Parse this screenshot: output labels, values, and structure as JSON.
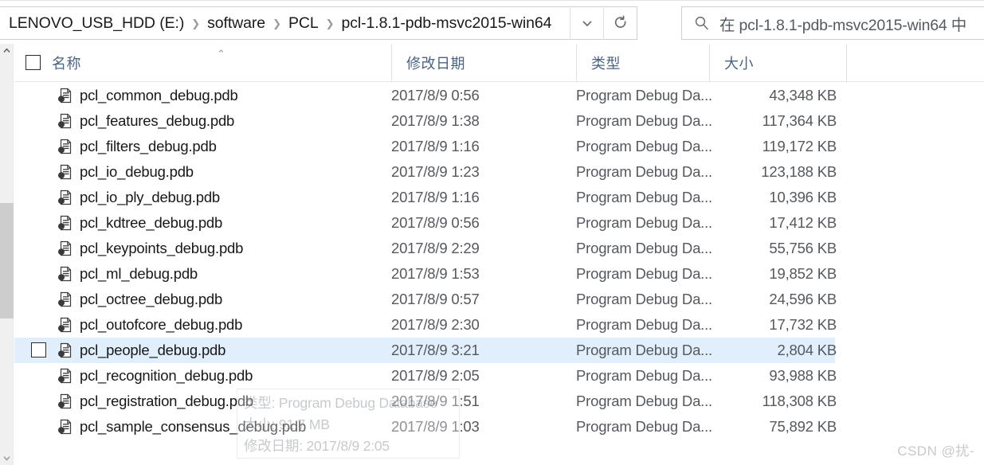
{
  "address_bar": {
    "breadcrumb": [
      "LENOVO_USB_HDD (E:)",
      "software",
      "PCL",
      "pcl-1.8.1-pdb-msvc2015-win64"
    ],
    "separator": "❯",
    "dropdown_icon": "chevron-down-icon",
    "refresh_icon": "refresh-icon"
  },
  "search": {
    "icon": "search-icon",
    "placeholder": "在 pcl-1.8.1-pdb-msvc2015-win64 中"
  },
  "columns": {
    "name": "名称",
    "date_modified": "修改日期",
    "type": "类型",
    "size": "大小",
    "sort_indicator": "⌃"
  },
  "files": [
    {
      "name": "pcl_common_debug.pdb",
      "date": "2017/8/9 0:56",
      "type": "Program Debug Da...",
      "size": "43,348 KB",
      "selected": false
    },
    {
      "name": "pcl_features_debug.pdb",
      "date": "2017/8/9 1:38",
      "type": "Program Debug Da...",
      "size": "117,364 KB",
      "selected": false
    },
    {
      "name": "pcl_filters_debug.pdb",
      "date": "2017/8/9 1:16",
      "type": "Program Debug Da...",
      "size": "119,172 KB",
      "selected": false
    },
    {
      "name": "pcl_io_debug.pdb",
      "date": "2017/8/9 1:23",
      "type": "Program Debug Da...",
      "size": "123,188 KB",
      "selected": false
    },
    {
      "name": "pcl_io_ply_debug.pdb",
      "date": "2017/8/9 1:16",
      "type": "Program Debug Da...",
      "size": "10,396 KB",
      "selected": false
    },
    {
      "name": "pcl_kdtree_debug.pdb",
      "date": "2017/8/9 0:56",
      "type": "Program Debug Da...",
      "size": "17,412 KB",
      "selected": false
    },
    {
      "name": "pcl_keypoints_debug.pdb",
      "date": "2017/8/9 2:29",
      "type": "Program Debug Da...",
      "size": "55,756 KB",
      "selected": false
    },
    {
      "name": "pcl_ml_debug.pdb",
      "date": "2017/8/9 1:53",
      "type": "Program Debug Da...",
      "size": "19,852 KB",
      "selected": false
    },
    {
      "name": "pcl_octree_debug.pdb",
      "date": "2017/8/9 0:57",
      "type": "Program Debug Da...",
      "size": "24,596 KB",
      "selected": false
    },
    {
      "name": "pcl_outofcore_debug.pdb",
      "date": "2017/8/9 2:30",
      "type": "Program Debug Da...",
      "size": "17,732 KB",
      "selected": false
    },
    {
      "name": "pcl_people_debug.pdb",
      "date": "2017/8/9 3:21",
      "type": "Program Debug Da...",
      "size": "2,804 KB",
      "selected": true
    },
    {
      "name": "pcl_recognition_debug.pdb",
      "date": "2017/8/9 2:05",
      "type": "Program Debug Da...",
      "size": "93,988 KB",
      "selected": false
    },
    {
      "name": "pcl_registration_debug.pdb",
      "date": "2017/8/9 1:51",
      "type": "Program Debug Da...",
      "size": "118,308 KB",
      "selected": false
    },
    {
      "name": "pcl_sample_consensus_debug.pdb",
      "date": "2017/8/9 1:03",
      "type": "Program Debug Da...",
      "size": "75,892 KB",
      "selected": false
    }
  ],
  "tooltip": {
    "type_line": "类型: Program Debug Database",
    "size_line": "大小: 91.7 MB",
    "date_line": "修改日期: 2017/8/9 2:05"
  },
  "watermark": {
    "text": "CSDN @扰-"
  },
  "colors": {
    "selection": "#e1eefb",
    "header_text": "#4a6484",
    "body_text": "#55595e",
    "name_text": "#181818"
  }
}
